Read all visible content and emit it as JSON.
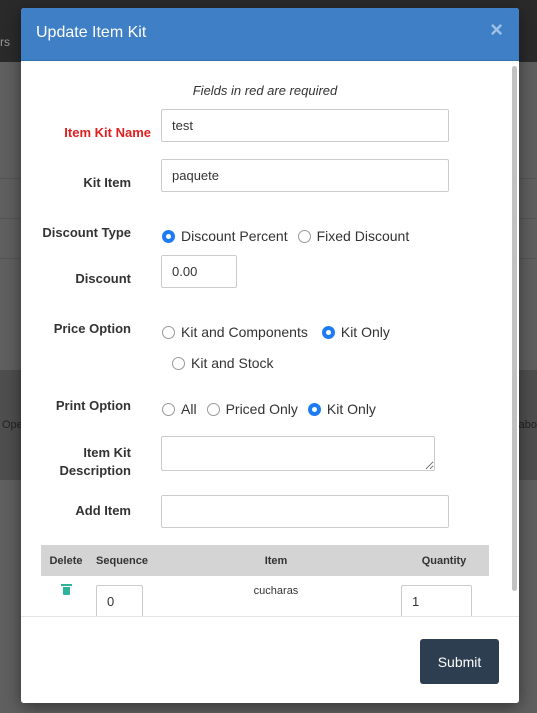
{
  "background": {
    "topbar_text": "rs",
    "band_left": "Ope",
    "band_right": "abo"
  },
  "modal": {
    "title": "Update Item Kit",
    "close_symbol": "×",
    "note": "Fields in red are required",
    "fields": {
      "name": {
        "label": "Item Kit Name",
        "value": "test",
        "required": true
      },
      "kit_item": {
        "label": "Kit Item",
        "value": "paquete"
      },
      "discount_type": {
        "label": "Discount Type",
        "options": [
          "Discount Percent",
          "Fixed Discount"
        ],
        "selected": "Discount Percent"
      },
      "discount": {
        "label": "Discount",
        "value": "0.00"
      },
      "price_option": {
        "label": "Price Option",
        "options": [
          "Kit and Components",
          "Kit Only",
          "Kit and Stock"
        ],
        "selected": "Kit Only"
      },
      "print_option": {
        "label": "Print Option",
        "options": [
          "All",
          "Priced Only",
          "Kit Only"
        ],
        "selected": "Kit Only"
      },
      "description": {
        "label_line1": "Item Kit",
        "label_line2": "Description",
        "value": ""
      },
      "add_item": {
        "label": "Add Item",
        "value": ""
      }
    },
    "table": {
      "headers": [
        "Delete",
        "Sequence",
        "Item",
        "Quantity"
      ],
      "rows": [
        {
          "sequence": "0",
          "item": "cucharas",
          "quantity": "1"
        }
      ]
    },
    "submit_label": "Submit"
  },
  "colors": {
    "header": "#3f7fc5",
    "required": "#e02020",
    "radio_selected": "#1e7cf2",
    "submit": "#2c3e50",
    "trash": "#2fb39a"
  }
}
